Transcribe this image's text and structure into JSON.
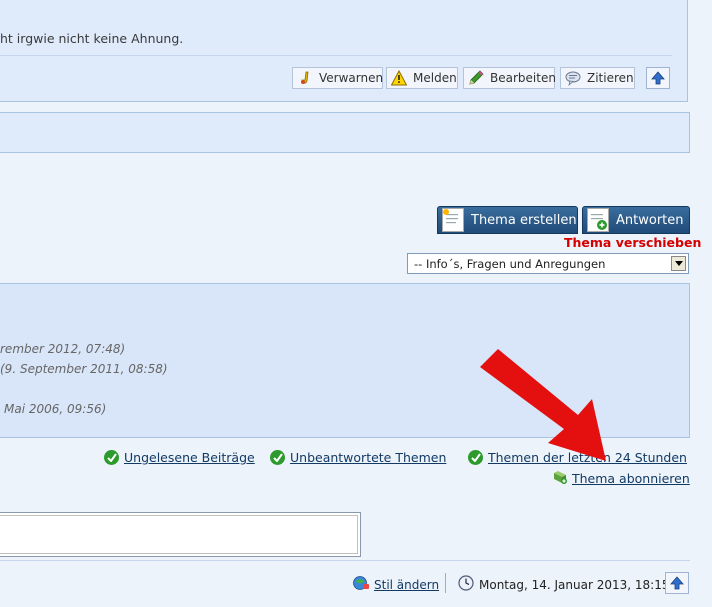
{
  "post": {
    "text": "ht irgwie nicht keine Ahnung.",
    "buttons": {
      "warn": "Verwarnen",
      "report": "Melden",
      "edit": "Bearbeiten",
      "quote": "Zitieren"
    }
  },
  "thread_actions": {
    "new_topic": "Thema erstellen",
    "reply": "Antworten",
    "move": "Thema verschieben",
    "board_select": "-- Info´s, Fragen und Anregungen"
  },
  "info_lines": [
    "rember 2012, 07:48)",
    "(9. September 2011, 08:58)",
    "Mai 2006, 09:56)"
  ],
  "quick_links": {
    "unread": "Ungelesene Beiträge",
    "unanswered": "Unbeantwortete Themen",
    "last24": "Themen der letzten 24 Stunden",
    "subscribe": "Thema abonnieren"
  },
  "footer": {
    "style": "Stil ändern",
    "datetime": "Montag, 14. Januar 2013, 18:15"
  },
  "colors": {
    "annotation_arrow": "#e41010",
    "move_label": "#d40000",
    "link": "#123a63"
  },
  "icons": [
    "warn-icon",
    "report-icon",
    "edit-icon",
    "quote-icon",
    "up-arrow-icon",
    "new-topic-icon",
    "reply-icon",
    "check-icon",
    "subscribe-icon",
    "style-icon",
    "clock-icon",
    "dropdown-arrow-icon"
  ]
}
